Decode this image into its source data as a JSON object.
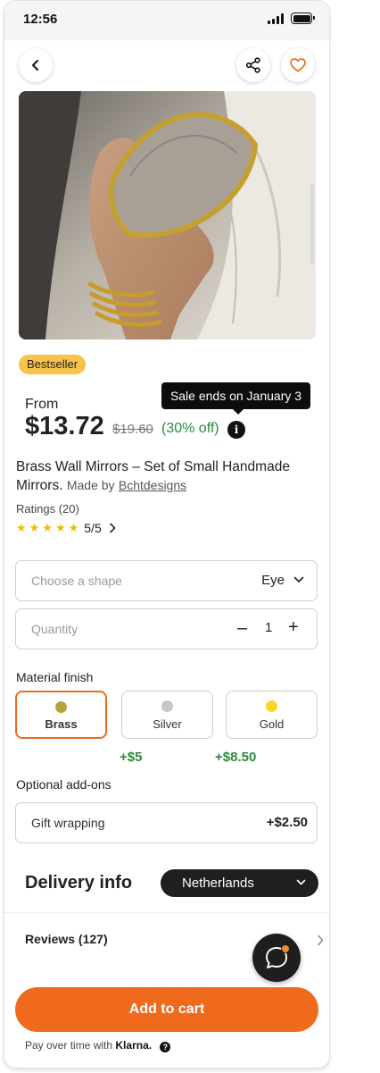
{
  "status_bar": {
    "time": "12:56"
  },
  "header": {
    "back_icon": "chevron-left-icon",
    "share_icon": "share-icon",
    "favorite_icon": "heart-icon"
  },
  "product": {
    "badge": "Bestseller",
    "tooltip": "Sale ends on January 3",
    "price_prefix": "From",
    "price": "$13.72",
    "original_price": "$19.60",
    "discount": "(30% off)",
    "info_icon_glyph": "i",
    "title": "Brass Wall Mirrors – Set of Small Handmade Mirrors.",
    "made_by_label": "Made by",
    "shop_name": "Bchtdesigns",
    "ratings_label": "Ratings (20)",
    "rating_stars": 5,
    "rating_score": "5/5"
  },
  "options": {
    "shape": {
      "placeholder": "Choose a shape",
      "value": "Eye"
    },
    "quantity": {
      "placeholder": "Quantity",
      "minus": "–",
      "value": "1",
      "plus": "+"
    },
    "material_label": "Material finish",
    "materials": [
      {
        "label": "Brass",
        "color": "#b5a33f",
        "selected": true
      },
      {
        "label": "Silver",
        "color": "#c6c6c6",
        "price_delta": "+$5"
      },
      {
        "label": "Gold",
        "color": "#f6d928",
        "price_delta": "+$8.50"
      }
    ],
    "addons_label": "Optional add-ons",
    "addon": {
      "label": "Gift wrapping",
      "price": "+$2.50"
    }
  },
  "delivery": {
    "title": "Delivery info",
    "country": "Netherlands"
  },
  "reviews": {
    "label": "Reviews (127)"
  },
  "cta": {
    "add_to_cart": "Add to cart",
    "pay_over_time": "Pay over time with",
    "klarna": "Klarna.",
    "help_glyph": "?"
  },
  "colors": {
    "accent": "#f06a1d",
    "sale_green": "#2b8a3e",
    "badge": "#f7c34a",
    "star": "#f5b800"
  }
}
